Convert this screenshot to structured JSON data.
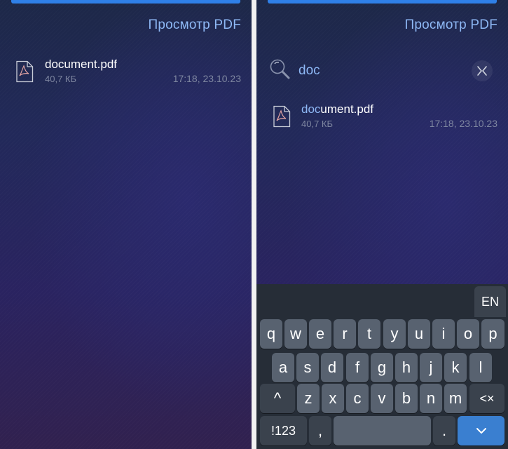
{
  "left_screen": {
    "header_link": "Просмотр PDF",
    "file": {
      "name": "document.pdf",
      "size": "40,7 КБ",
      "date": "17:18, 23.10.23"
    }
  },
  "right_screen": {
    "header_link": "Просмотр PDF",
    "search": {
      "query": "doc"
    },
    "file": {
      "name_match": "doc",
      "name_rest": "ument.pdf",
      "size": "40,7 КБ",
      "date": "17:18, 23.10.23"
    },
    "keyboard": {
      "language": "EN",
      "row1": [
        "q",
        "w",
        "e",
        "r",
        "t",
        "y",
        "u",
        "i",
        "o",
        "p"
      ],
      "row2": [
        "a",
        "s",
        "d",
        "f",
        "g",
        "h",
        "j",
        "k",
        "l"
      ],
      "row3": [
        "z",
        "x",
        "c",
        "v",
        "b",
        "n",
        "m"
      ],
      "shift_glyph": "^",
      "backspace_glyph": "<×",
      "numbers_label": "!123",
      "comma_label": ",",
      "period_label": "."
    }
  },
  "colors": {
    "accent": "#2f80e8",
    "link": "#8eb8f5",
    "key": "#586270",
    "key_dark": "#3a424d",
    "enter_key": "#3a7fd0"
  }
}
